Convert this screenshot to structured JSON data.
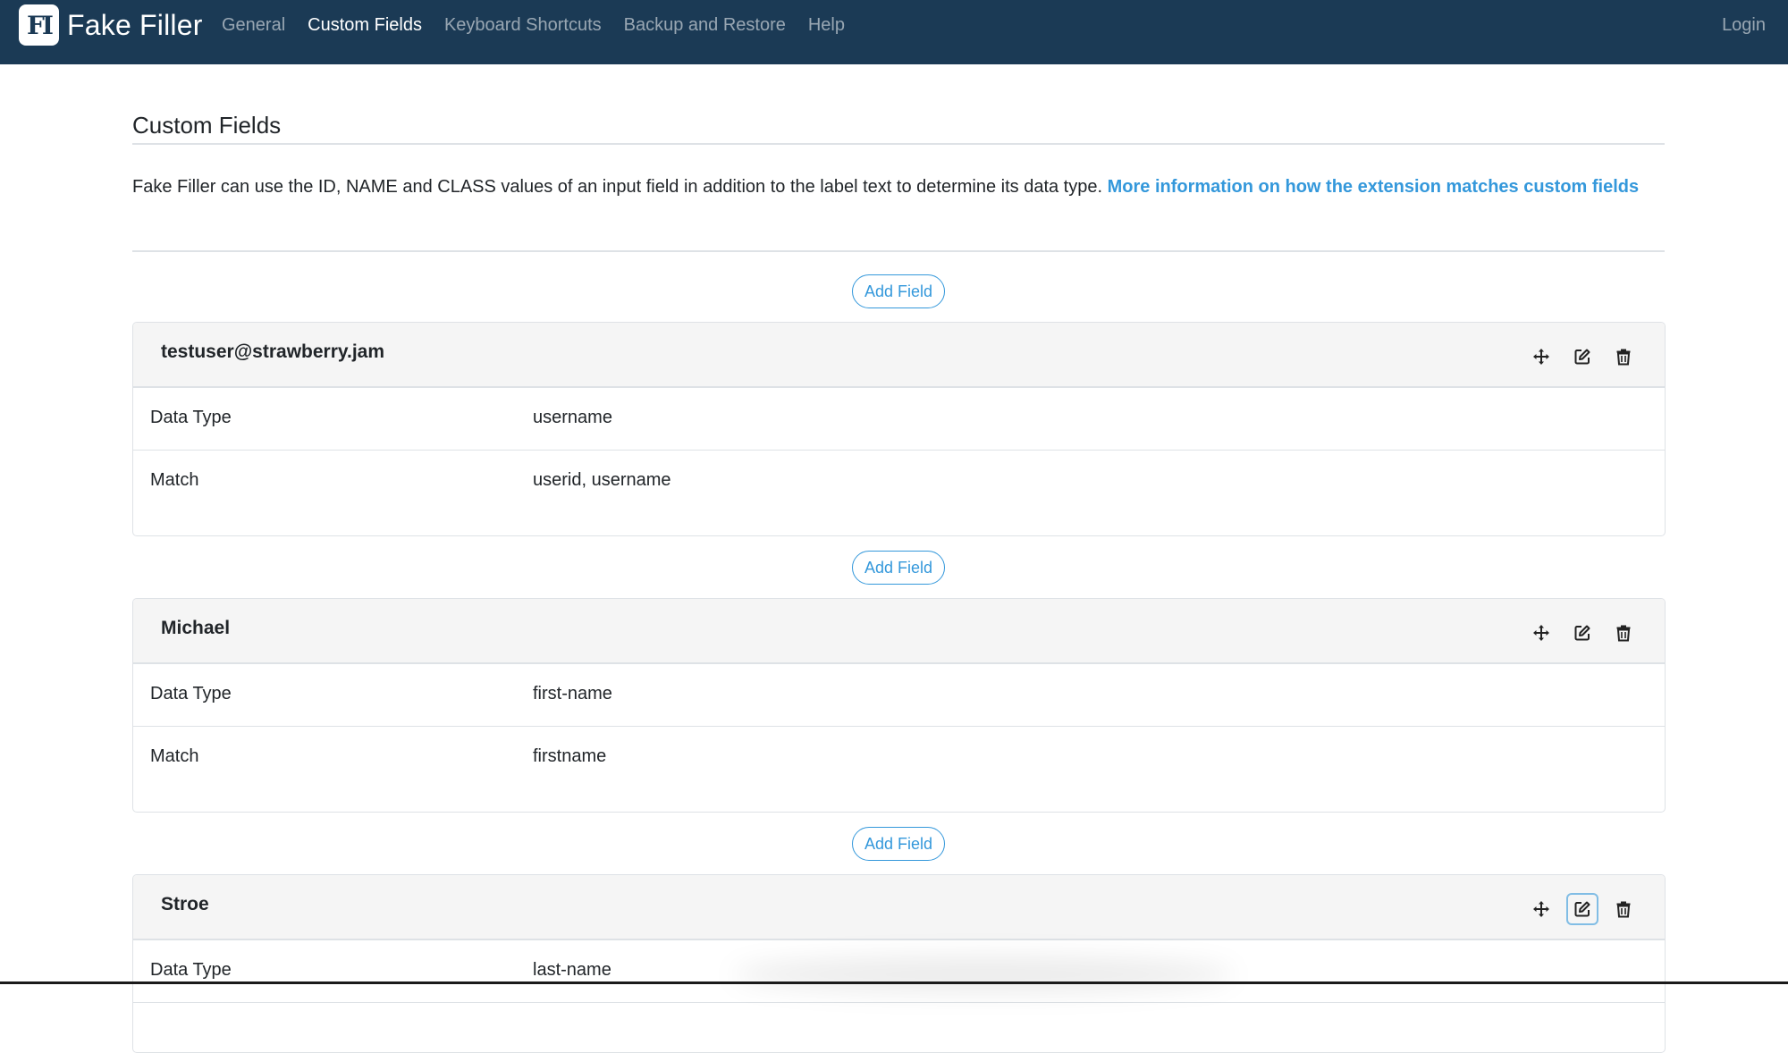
{
  "nav": {
    "logo_text": "FI",
    "brand": "Fake Filler",
    "links": [
      "General",
      "Custom Fields",
      "Keyboard Shortcuts",
      "Backup and Restore",
      "Help"
    ],
    "active": "Custom Fields",
    "login": "Login"
  },
  "page": {
    "title": "Custom Fields",
    "intro_text": "Fake Filler can use the ID, NAME and CLASS values of an input field in addition to the label text to determine its data type. ",
    "intro_link": "More information on how the extension matches custom fields",
    "add_field_label": "Add Field"
  },
  "labels": {
    "data_type": "Data Type",
    "match": "Match"
  },
  "fields": [
    {
      "name": "testuser@strawberry.jam",
      "data_type": "username",
      "match": "userid, username"
    },
    {
      "name": "Michael",
      "data_type": "first-name",
      "match": "firstname"
    },
    {
      "name": "Stroe",
      "data_type": "last-name",
      "match": ""
    }
  ],
  "icons": {
    "move": "move-arrows-icon",
    "edit": "edit-pencil-icon",
    "delete": "trash-icon"
  },
  "colors": {
    "navbar": "#1b3a55",
    "accent": "#3498db",
    "card_header": "#f5f5f5"
  }
}
